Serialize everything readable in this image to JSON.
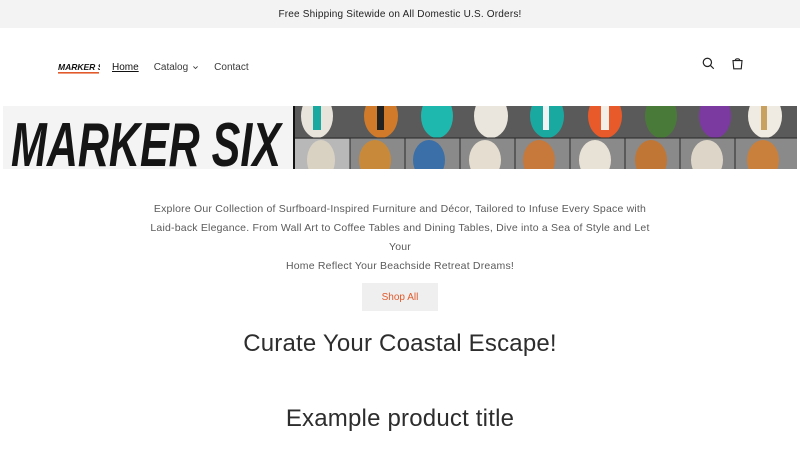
{
  "announcement": "Free Shipping Sitewide on All Domestic U.S. Orders!",
  "header": {
    "logo_text": "MARKER SIX",
    "nav": [
      {
        "label": "Home"
      },
      {
        "label": "Catalog"
      },
      {
        "label": "Contact"
      }
    ]
  },
  "banner": {
    "brand_text": "MARKER SIX"
  },
  "main": {
    "description_lines": [
      "Explore Our Collection of Surfboard-Inspired Furniture and Décor, Tailored to Infuse Every Space with",
      "Laid-back Elegance. From Wall Art to Coffee Tables and Dining Tables, Dive into a Sea of Style and Let Your",
      "Home Reflect Your Beachside Retreat Dreams!"
    ],
    "shop_all_label": "Shop All",
    "heading": "Curate Your Coastal Escape!",
    "product_title": "Example product title"
  },
  "colors": {
    "accent": "#e25a2b",
    "announcement_bg": "#f3f3f3"
  },
  "icons": {
    "search": "search-icon",
    "cart": "cart-icon",
    "catalog_dropdown": "chevron-down-icon"
  }
}
